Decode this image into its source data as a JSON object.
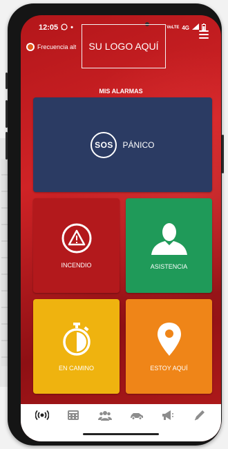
{
  "status_bar": {
    "time": "12:05",
    "signal_text": "4G"
  },
  "app_bar": {
    "brand_name": "Frecuencia alta",
    "logo_placeholder": "SU LOGO AQUÍ"
  },
  "section_title": "MIS ALARMAS",
  "tiles": {
    "panico": {
      "badge": "SOS",
      "label": "PÁNICO",
      "color": "#2b3b63"
    },
    "incendio": {
      "label": "INCENDIO",
      "color": "#b3191c"
    },
    "asistencia": {
      "label": "ASISTENCIA",
      "color": "#1f9a59"
    },
    "en_camino": {
      "label": "EN CAMINO",
      "color": "#efb30f"
    },
    "estoy_aqui": {
      "label": "ESTOY AQUÍ",
      "color": "#ef8518"
    }
  },
  "bottom_nav": {
    "items": [
      "broadcast-icon",
      "calculator-icon",
      "group-icon",
      "car-icon",
      "megaphone-icon",
      "pen-icon"
    ],
    "active": "broadcast-icon"
  },
  "colors": {
    "accent_red": "#c8181c"
  }
}
